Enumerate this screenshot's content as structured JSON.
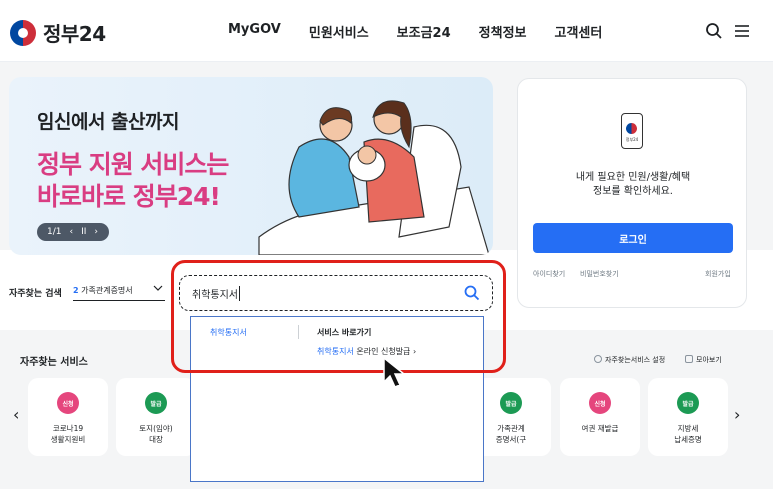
{
  "header": {
    "logo_text": "정부24",
    "nav": [
      "MyGOV",
      "민원서비스",
      "보조금24",
      "정책정보",
      "고객센터"
    ],
    "icons": [
      "search-icon",
      "menu-icon"
    ]
  },
  "banner": {
    "subtitle": "임신에서 출산까지",
    "title_line1": "정부 지원 서비스는",
    "title_line2": "바로바로 정부24!",
    "pager": "1/1",
    "prev": "‹",
    "pause": "II",
    "next": "›"
  },
  "login": {
    "phone_label": "정부24",
    "message_line1": "내게 필요한 민원/생활/혜택",
    "message_line2": "정보를 확인하세요.",
    "button": "로그인",
    "find_id": "아이디찾기",
    "find_pw": "비밀번호찾기",
    "signup": "회원가입"
  },
  "search": {
    "freq_label": "자주찾는 검색",
    "freq_num": "2",
    "freq_value": "가족관계증명서",
    "query": "취학통지서"
  },
  "dropdown": {
    "suggestion": "취학통지서",
    "heading": "서비스 바로가기",
    "link_highlight": "취학통지서",
    "link_rest": " 온라인 신청발급",
    "link_arrow": "›"
  },
  "services": {
    "title": "자주찾는 서비스",
    "settings": "자주찾는서비스 설정",
    "view_all": "모아보기",
    "prev_arrow": "‹",
    "next_arrow": "›",
    "cards": [
      {
        "badge": "신청",
        "label": "코로나19\n생활지원비",
        "color": "#e5467d"
      },
      {
        "badge": "발급",
        "label": "토지(임야)\n대장",
        "color": "#1c9a54"
      },
      {
        "badge": "발급",
        "label": "가족관계\n증명서(구",
        "color": "#1c9a54"
      },
      {
        "badge": "신청",
        "label": "여권 재발급",
        "color": "#e5467d"
      },
      {
        "badge": "발급",
        "label": "지방세\n납세증명",
        "color": "#1c9a54"
      }
    ]
  }
}
